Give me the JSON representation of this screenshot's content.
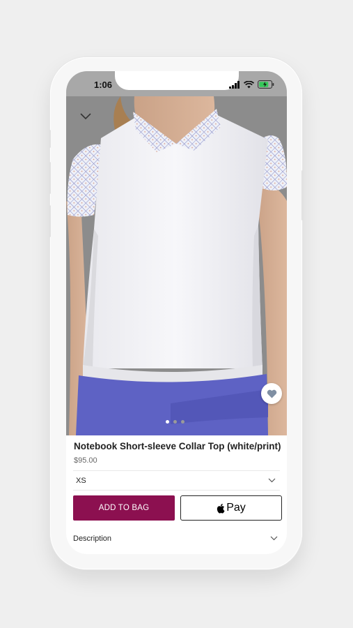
{
  "status_bar": {
    "time": "1:06"
  },
  "product": {
    "title": "Notebook Short-sleeve Collar Top (white/print)",
    "price": "$95.00",
    "image_dots": 3,
    "active_dot": 0
  },
  "size": {
    "selected": "XS"
  },
  "actions": {
    "add_to_bag": "ADD TO BAG",
    "apple_pay": "Pay"
  },
  "sections": {
    "description": "Description"
  },
  "colors": {
    "add_to_bag_bg": "#8c1050",
    "skirt": "#5e62c4"
  },
  "icons": [
    "chevron-down-icon",
    "heart-icon",
    "apple-logo-icon",
    "signal-icon",
    "wifi-icon",
    "battery-icon"
  ]
}
